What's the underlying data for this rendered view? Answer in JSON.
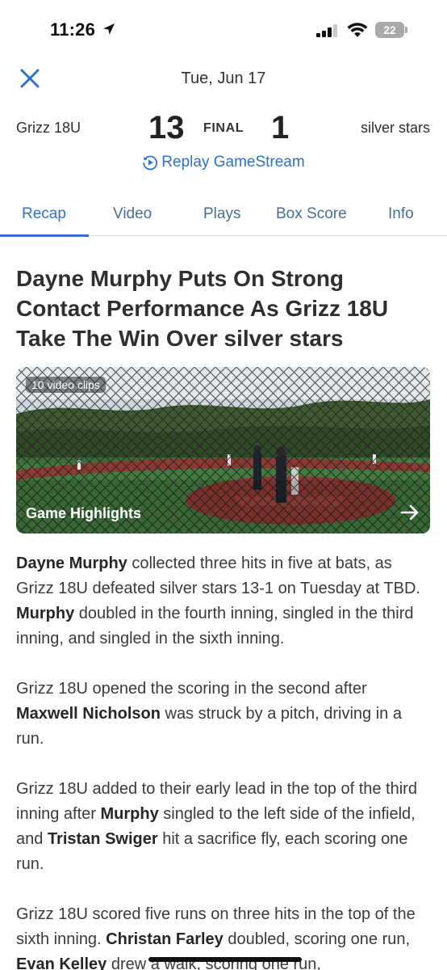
{
  "status_bar": {
    "time": "11:26",
    "battery": "22"
  },
  "header": {
    "date": "Tue, Jun 17"
  },
  "score": {
    "home_team": "Grizz 18U",
    "home_score": "13",
    "status": "FINAL",
    "away_score": "1",
    "away_team": "silver stars"
  },
  "replay_label": "Replay GameStream",
  "tabs": [
    {
      "label": "Recap",
      "active": true
    },
    {
      "label": "Video",
      "active": false
    },
    {
      "label": "Plays",
      "active": false
    },
    {
      "label": "Box Score",
      "active": false
    },
    {
      "label": "Info",
      "active": false
    }
  ],
  "article": {
    "headline": "Dayne Murphy Puts On Strong Contact Performance As Grizz 18U Take The Win Over silver stars",
    "media": {
      "clips_badge": "10 video clips",
      "label": "Game Highlights"
    },
    "paragraphs": [
      {
        "segments": [
          {
            "text": "Dayne Murphy",
            "bold": true
          },
          {
            "text": " collected three hits in five at bats, as Grizz 18U defeated silver stars 13-1 on Tuesday at TBD. ",
            "bold": false
          },
          {
            "text": "Murphy",
            "bold": true
          },
          {
            "text": " doubled in the fourth inning, singled in the third inning, and singled in the sixth inning.",
            "bold": false
          }
        ]
      },
      {
        "segments": [
          {
            "text": "Grizz 18U opened the scoring in the second after ",
            "bold": false
          },
          {
            "text": "Maxwell Nicholson",
            "bold": true
          },
          {
            "text": " was struck by a pitch, driving in a run.",
            "bold": false
          }
        ]
      },
      {
        "segments": [
          {
            "text": "Grizz 18U added to their early lead in the top of the third inning after ",
            "bold": false
          },
          {
            "text": "Murphy",
            "bold": true
          },
          {
            "text": " singled to the left side of the infield, and ",
            "bold": false
          },
          {
            "text": "Tristan Swiger",
            "bold": true
          },
          {
            "text": " hit a sacrifice fly, each scoring one run.",
            "bold": false
          }
        ]
      },
      {
        "segments": [
          {
            "text": "Grizz 18U scored five runs on three hits in the top of the sixth inning. ",
            "bold": false
          },
          {
            "text": "Christan Farley",
            "bold": true
          },
          {
            "text": " doubled, scoring one run, ",
            "bold": false
          },
          {
            "text": "Evan Kelley",
            "bold": true
          },
          {
            "text": " drew a walk, scoring one run,",
            "bold": false
          }
        ]
      }
    ]
  },
  "colors": {
    "accent": "#2d72c6",
    "text": "#2f2f2f",
    "tab_inactive": "#4a6e8f"
  }
}
